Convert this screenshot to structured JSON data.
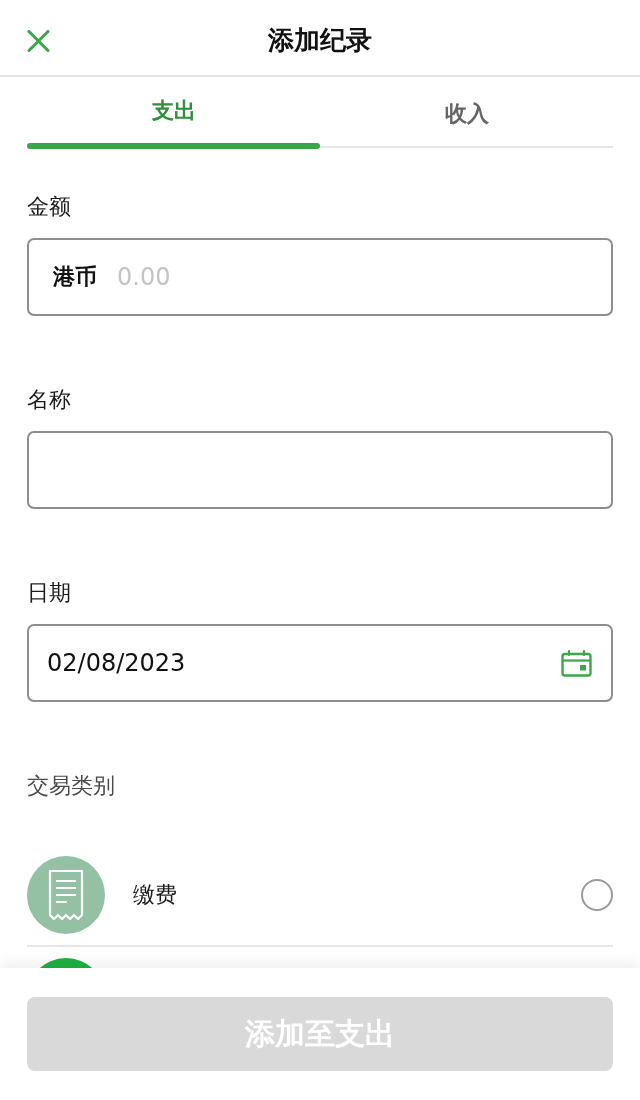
{
  "header": {
    "title": "添加纪录"
  },
  "tabs": [
    {
      "label": "支出",
      "selected": true
    },
    {
      "label": "收入",
      "selected": false
    }
  ],
  "fields": [
    {
      "kind": "amount",
      "label": "金额",
      "currency": "港币",
      "placeholder": "0.00"
    },
    {
      "kind": "text",
      "label": "名称"
    },
    {
      "kind": "date",
      "label": "日期",
      "value": "02/08/2023"
    }
  ],
  "category_section": {
    "label": "交易类别",
    "items": [
      {
        "label": "缴费",
        "color": "#94c1a4",
        "selected": false
      },
      {
        "color": "#1fb141"
      }
    ]
  },
  "submit_button": {
    "label": "添加至支出",
    "disabled": true
  }
}
